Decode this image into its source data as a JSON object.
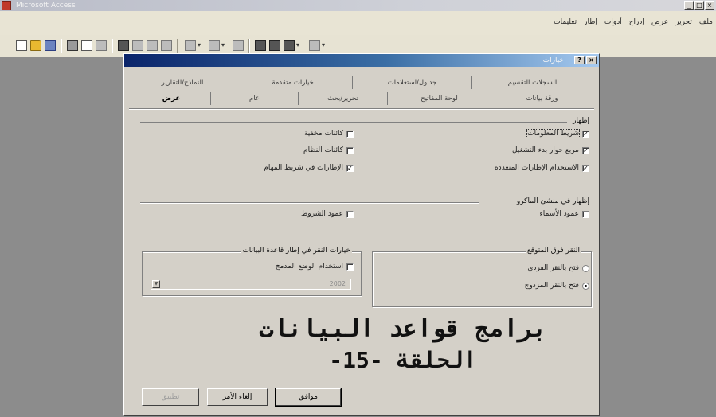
{
  "app": {
    "title": "Microsoft Access",
    "window_controls": [
      "_",
      "□",
      "×"
    ]
  },
  "menu": {
    "items": [
      "ملف",
      "تحرير",
      "عرض",
      "إدراج",
      "أدوات",
      "إطار",
      "تعليمات"
    ]
  },
  "toolbar": {
    "icons": [
      "new-icon",
      "open-icon",
      "save-icon",
      "print-icon",
      "preview-icon",
      "spelling-icon",
      "cut-icon",
      "copy-icon",
      "paste-icon",
      "undo-icon",
      "office-links-icon",
      "analyze-icon",
      "properties-icon",
      "relationships-icon",
      "new-object-icon",
      "help-icon"
    ]
  },
  "dialog": {
    "title": "خيارات",
    "controls": [
      "?",
      "×"
    ],
    "tabs_back": [
      "النماذج/التقارير",
      "خيارات متقدمة",
      "جداول/استعلامات",
      "السجلات التقسيم"
    ],
    "tabs_front": [
      "عرض",
      "عام",
      "تحرير/بحث",
      "لوحة المفاتيح",
      "ورقة بيانات"
    ],
    "active_tab": "عرض",
    "show": {
      "title": "إظهار",
      "items": [
        {
          "label": "شريط المعلومات",
          "checked": true
        },
        {
          "label": "مربع حوار بدء التشغيل",
          "checked": true
        },
        {
          "label": "الاستخدام الإطارات المتعددة",
          "checked": true
        },
        {
          "label": "كائنات مخفية",
          "checked": false
        },
        {
          "label": "كائنات النظام",
          "checked": false
        },
        {
          "label": "الإطارات في شريط المهام",
          "checked": true
        }
      ]
    },
    "macro": {
      "title": "إظهار في منشئ الماكرو",
      "items": [
        {
          "label": "عمود الأسماء",
          "checked": false
        },
        {
          "label": "عمود الشروط",
          "checked": false
        }
      ]
    },
    "click": {
      "title": "النقر فوق المتوقع",
      "options": [
        {
          "label": "فتح بالنقر الفردي",
          "selected": false
        },
        {
          "label": "فتح بالنقر المزدوج",
          "selected": true
        }
      ]
    },
    "dbwin": {
      "title": "خيارات النقر في إطار قاعدة البيانات",
      "checkbox": {
        "label": "استخدام الوضع المدمج",
        "checked": false
      },
      "select_value": "2002"
    },
    "overlay": {
      "line1": "برامج قواعد البيانات",
      "line2": "الحلقة -15-"
    },
    "buttons": {
      "ok": "موافق",
      "cancel": "إلغاء الأمر",
      "apply": "تطبيق"
    }
  }
}
